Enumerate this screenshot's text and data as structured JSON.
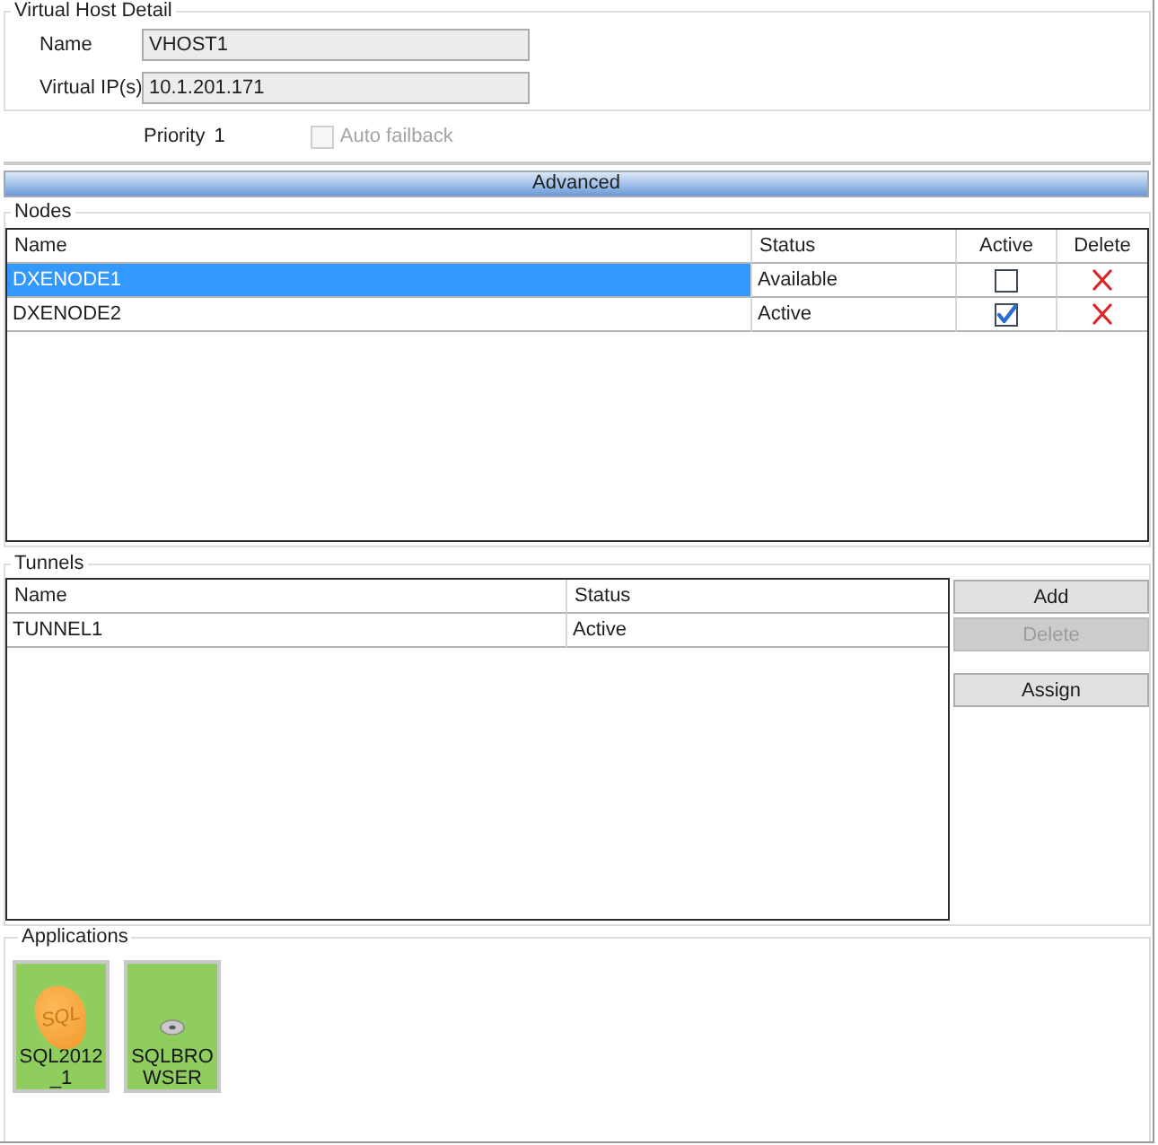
{
  "virtual_host_detail": {
    "title": "Virtual Host Detail",
    "fields": [
      {
        "label": "Name",
        "value": "VHOST1"
      },
      {
        "label": "Virtual IP(s)",
        "value": "10.1.201.171"
      }
    ]
  },
  "priority": {
    "label": "Priority",
    "value": "1"
  },
  "auto_failback": {
    "label": "Auto failback",
    "checked": false,
    "disabled": true
  },
  "advanced": {
    "label": "Advanced"
  },
  "nodes": {
    "title": "Nodes",
    "columns": [
      "Name",
      "Status",
      "Active",
      "Delete"
    ],
    "rows": [
      {
        "name": "DXENODE1",
        "status": "Available",
        "active": false,
        "selected": true
      },
      {
        "name": "DXENODE2",
        "status": "Active",
        "active": true,
        "selected": false
      }
    ]
  },
  "tunnels": {
    "title": "Tunnels",
    "columns": [
      "Name",
      "Status"
    ],
    "rows": [
      {
        "name": "TUNNEL1",
        "status": "Active",
        "selected": false
      }
    ],
    "buttons": [
      {
        "label": "Add",
        "disabled": false
      },
      {
        "label": "Delete",
        "disabled": true
      },
      {
        "label": "Assign",
        "disabled": false
      }
    ]
  },
  "applications": {
    "title": "Applications",
    "items": [
      {
        "kind": "sql",
        "badge": "SQL",
        "label": "SQL2012_1"
      },
      {
        "kind": "service",
        "label": "SQLBROWSER"
      }
    ]
  }
}
